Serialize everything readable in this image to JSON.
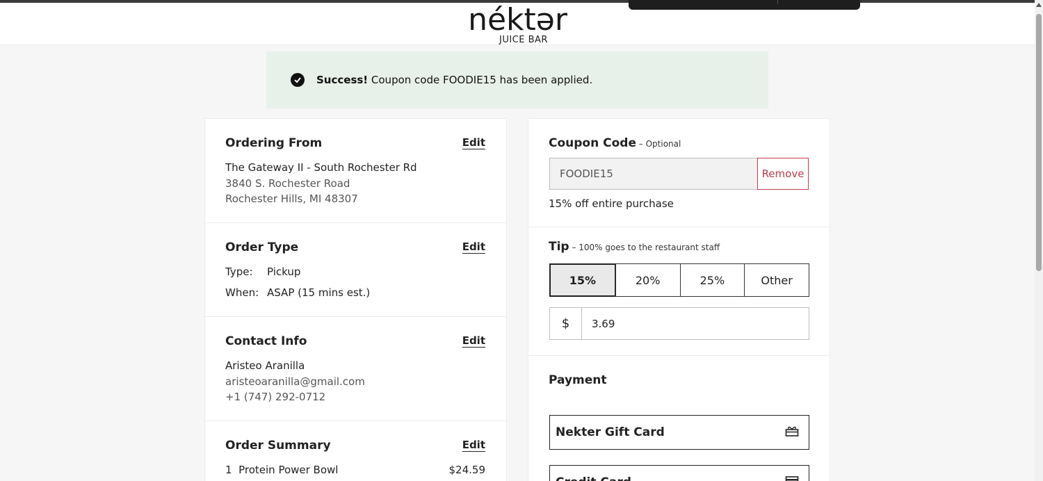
{
  "brand": {
    "name": "néktər",
    "sub": "JUICE BAR"
  },
  "alert": {
    "strong": "Success!",
    "message": " Coupon code FOODIE15 has been applied."
  },
  "ordering_from": {
    "title": "Ordering From",
    "edit": "Edit",
    "store": "The Gateway II - South Rochester Rd",
    "address1": "3840 S. Rochester Road",
    "address2": "Rochester Hills, MI 48307"
  },
  "order_type": {
    "title": "Order Type",
    "edit": "Edit",
    "type_label": "Type:",
    "type_value": "Pickup",
    "when_label": "When:",
    "when_value": "ASAP (15 mins est.)"
  },
  "contact": {
    "title": "Contact Info",
    "edit": "Edit",
    "name": "Aristeo Aranilla",
    "email": "aristeoaranilla@gmail.com",
    "phone": "+1 (747) 292-0712"
  },
  "summary": {
    "title": "Order Summary",
    "edit": "Edit",
    "items": [
      {
        "qty": "1",
        "name": "Protein Power Bowl",
        "price": "$24.59"
      }
    ]
  },
  "coupon": {
    "title": "Coupon Code",
    "optional": " – Optional",
    "code": "FOODIE15",
    "remove": "Remove",
    "description": "15% off entire purchase"
  },
  "tip": {
    "title": "Tip",
    "note": " – 100% goes to the restaurant staff",
    "options": [
      "15%",
      "20%",
      "25%",
      "Other"
    ],
    "selected": "15%",
    "currency": "$",
    "amount": "3.69"
  },
  "payment": {
    "title": "Payment",
    "options": [
      "Nekter Gift Card",
      "Credit Card"
    ]
  }
}
